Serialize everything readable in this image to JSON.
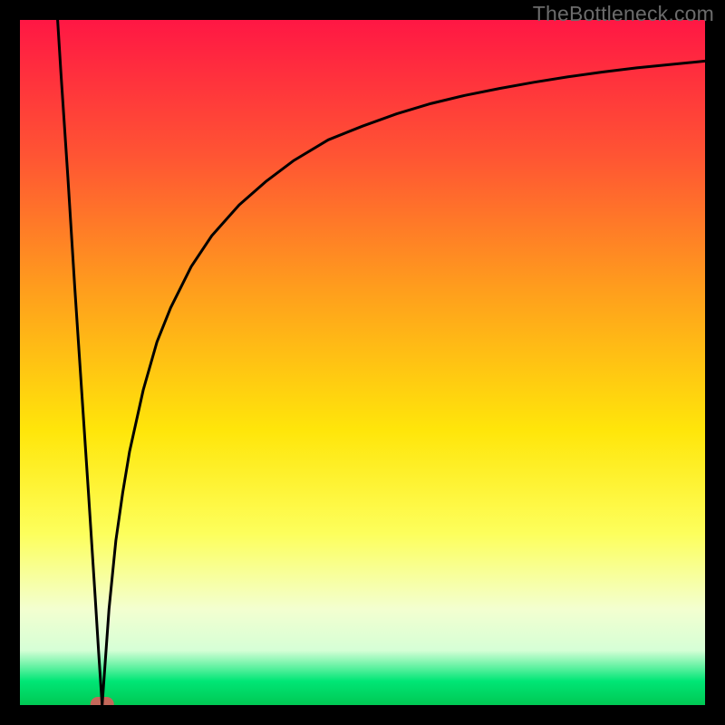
{
  "watermark": {
    "text": "TheBottleneck.com"
  },
  "chart_data": {
    "type": "line",
    "title": "",
    "xlabel": "",
    "ylabel": "",
    "xlim": [
      0,
      100
    ],
    "ylim": [
      0,
      100
    ],
    "grid": false,
    "legend_position": "none",
    "gradient_stops": [
      {
        "offset": 0.0,
        "color": "#ff1744"
      },
      {
        "offset": 0.2,
        "color": "#ff5533"
      },
      {
        "offset": 0.4,
        "color": "#ffa01c"
      },
      {
        "offset": 0.6,
        "color": "#ffe60a"
      },
      {
        "offset": 0.75,
        "color": "#fdff5c"
      },
      {
        "offset": 0.86,
        "color": "#f3ffd0"
      },
      {
        "offset": 0.92,
        "color": "#d6ffd6"
      },
      {
        "offset": 0.965,
        "color": "#00e676"
      },
      {
        "offset": 1.0,
        "color": "#00c853"
      }
    ],
    "min_marker": {
      "x": 12,
      "y": 0,
      "color": "#c4685a"
    },
    "series": [
      {
        "name": "curve",
        "color": "#000000",
        "x": [
          5.5,
          6,
          7,
          8,
          9,
          10,
          11,
          11.5,
          12,
          12.5,
          13,
          14,
          15,
          16,
          18,
          20,
          22,
          25,
          28,
          32,
          36,
          40,
          45,
          50,
          55,
          60,
          65,
          70,
          75,
          80,
          85,
          90,
          95,
          100
        ],
        "values": [
          100,
          92,
          77,
          61,
          46,
          31,
          15.5,
          7.5,
          0,
          7,
          14,
          24,
          31,
          37,
          46,
          53,
          58,
          64,
          68.5,
          73,
          76.5,
          79.5,
          82.5,
          84.5,
          86.3,
          87.8,
          89,
          90,
          90.9,
          91.7,
          92.4,
          93,
          93.5,
          94
        ]
      }
    ],
    "frame": {
      "stroke": "#000000",
      "width": 22
    }
  }
}
